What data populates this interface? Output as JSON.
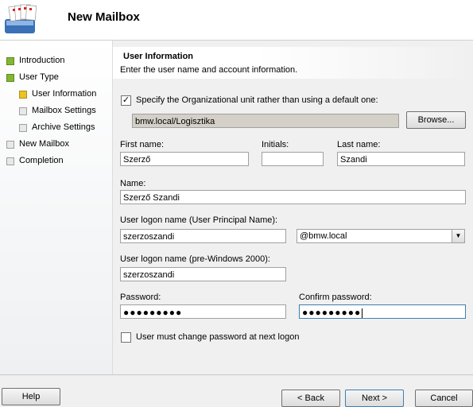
{
  "wizard": {
    "title": "New Mailbox"
  },
  "sidebar": {
    "steps": [
      {
        "label": "Introduction",
        "state": "done"
      },
      {
        "label": "User Type",
        "state": "done"
      },
      {
        "label": "User Information",
        "state": "current"
      },
      {
        "label": "Mailbox Settings",
        "state": "pending"
      },
      {
        "label": "Archive Settings",
        "state": "pending"
      },
      {
        "label": "New Mailbox",
        "state": "pending"
      },
      {
        "label": "Completion",
        "state": "pending"
      }
    ]
  },
  "page": {
    "title": "User Information",
    "description": "Enter the user name and account information."
  },
  "ou": {
    "checkbox_label": "Specify the Organizational unit rather than using a default one:",
    "checked": true,
    "value": "bmw.local/Logisztika",
    "browse_label": "Browse..."
  },
  "form": {
    "first_name_label": "First name:",
    "first_name": "Szerző",
    "initials_label": "Initials:",
    "initials": "",
    "last_name_label": "Last name:",
    "last_name": "Szandi",
    "name_label": "Name:",
    "name": "Szerző Szandi",
    "upn_label": "User logon name (User Principal Name):",
    "upn": "szerzoszandi",
    "domain": "@bmw.local",
    "pre2000_label": "User logon name (pre-Windows 2000):",
    "pre2000": "szerzoszandi",
    "password_label": "Password:",
    "password": "●●●●●●●●●",
    "confirm_label": "Confirm password:",
    "confirm": "●●●●●●●●●",
    "must_change_label": "User must change password at next logon",
    "must_change": false
  },
  "buttons": {
    "help": "Help",
    "back": "< Back",
    "next": "Next >",
    "cancel": "Cancel"
  },
  "colors": {
    "done": "#82b633",
    "current": "#ecc320",
    "pending": "#e8e8e8"
  }
}
